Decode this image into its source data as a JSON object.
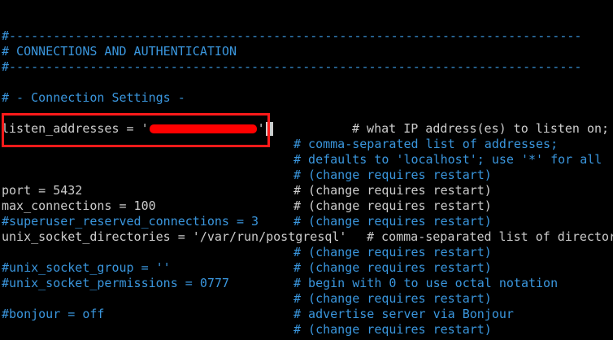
{
  "colors": {
    "background": "#000000",
    "comment": "#3a96dd",
    "text": "#cccccc",
    "highlight": "#ff1a1a"
  },
  "lines": {
    "sep1": "#------------------------------------------------------------------------------",
    "section": "# CONNECTIONS AND AUTHENTICATION",
    "sep2": "#------------------------------------------------------------------------------",
    "subsection": "# - Connection Settings -",
    "listen_pre": "listen_addresses = '",
    "listen_post": "'",
    "listen_comment": "# what IP address(es) to listen on;",
    "c_comma_list": "# comma-separated list of addresses;",
    "c_defaults": "# defaults to 'localhost'; use '*' for all",
    "c_restart1": "# (change requires restart)",
    "port": "port = 5432",
    "c_restart2": "# (change requires restart)",
    "max_conn": "max_connections = 100",
    "c_restart3": "# (change requires restart)",
    "superuser": "#superuser_reserved_connections = 3",
    "c_restart4": "# (change requires restart)",
    "unix_dirs": "unix_socket_directories = '/var/run/postgresql'",
    "c_unix_dirs": "# comma-separated list of directories",
    "c_restart5": "# (change requires restart)",
    "unix_group": "#unix_socket_group = ''",
    "c_restart6": "# (change requires restart)",
    "unix_perms": "#unix_socket_permissions = 0777",
    "c_octal": "# begin with 0 to use octal notation",
    "c_restart7": "# (change requires restart)",
    "bonjour": "#bonjour = off",
    "c_bonjour": "# advertise server via Bonjour",
    "c_restart8": "# (change requires restart)"
  }
}
